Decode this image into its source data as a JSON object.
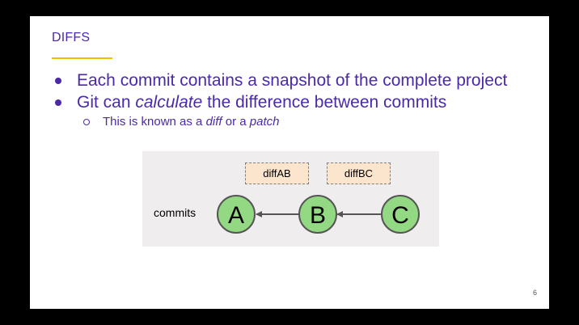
{
  "slide": {
    "title": "DIFFS",
    "page_number": "6",
    "bullets": [
      {
        "pre": "Each commit contains a snapshot of the complete project",
        "em": "",
        "post": ""
      },
      {
        "pre": "Git can ",
        "em": "calculate",
        "post": " the difference between commits"
      }
    ],
    "sub_bullet": {
      "pre": "This is known as a ",
      "em1": "diff",
      "mid": " or a ",
      "em2": "patch"
    }
  },
  "diagram": {
    "row_label": "commits",
    "diffs": [
      "diffAB",
      "diffBC"
    ],
    "nodes": [
      "A",
      "B",
      "C"
    ]
  },
  "colors": {
    "accent_text": "#4a2aa8",
    "title_rule": "#f2c200",
    "node_fill": "#93d882",
    "diff_fill": "#fce5cd",
    "diagram_bg": "#efeded"
  }
}
